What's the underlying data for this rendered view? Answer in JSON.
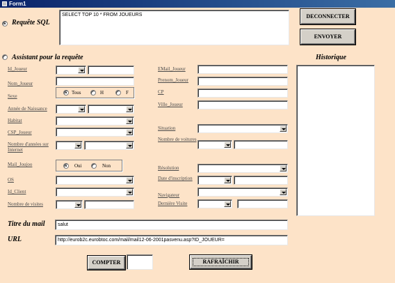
{
  "window": {
    "title": "Form1"
  },
  "sql": {
    "radio_label": "Requête SQL",
    "query": "SELECT TOP 10 * FROM JOUEURS",
    "disconnect_label": "DECONNECTER",
    "send_label": "ENVOYER"
  },
  "assistant": {
    "radio_label": "Assistant pour la requête",
    "history_label": "Historique",
    "left_labels": {
      "id_joueur": "Id_Joueur",
      "nom_joueur": "Nom_Joueur",
      "sexe": "Sexe",
      "annee": "Année de Naissance",
      "habitat": "Habitat",
      "csp": "CSP_Joueur",
      "nb_annees": "Nombre d'années sur Internet",
      "mail_joujoo": "Mail_Joujoo",
      "os": "OS",
      "id_client": "Id_Client",
      "nb_visites": "Nombre de visites"
    },
    "sexe_options": {
      "tous": "Tous",
      "h": "H",
      "f": "F"
    },
    "mail_options": {
      "oui": "Oui",
      "non": "Non"
    },
    "right_labels": {
      "email": "EMail_Joueur",
      "prenom": "Prenom_Joueur",
      "cp": "CP",
      "ville": "Ville_Joueur",
      "situation": "Situation",
      "nb_voitures": "Nombre de voitures",
      "resolution": "Résolution",
      "date_inscription": "Date d'inscription",
      "navigateur": "Navigateur",
      "derniere_visite": "Dernière Visite"
    }
  },
  "mail": {
    "titre_label": "Titre du mail",
    "titre_value": "salut",
    "url_label": "URL",
    "url_value": "http://eurob2c.eurobtoc.com/mail/mail12-06-2001pasvenu.asp?ID_JOUEUR="
  },
  "footer": {
    "count_label": "COMPTER",
    "count_value": "",
    "refresh_label": "RAFRAÎCHIR"
  }
}
